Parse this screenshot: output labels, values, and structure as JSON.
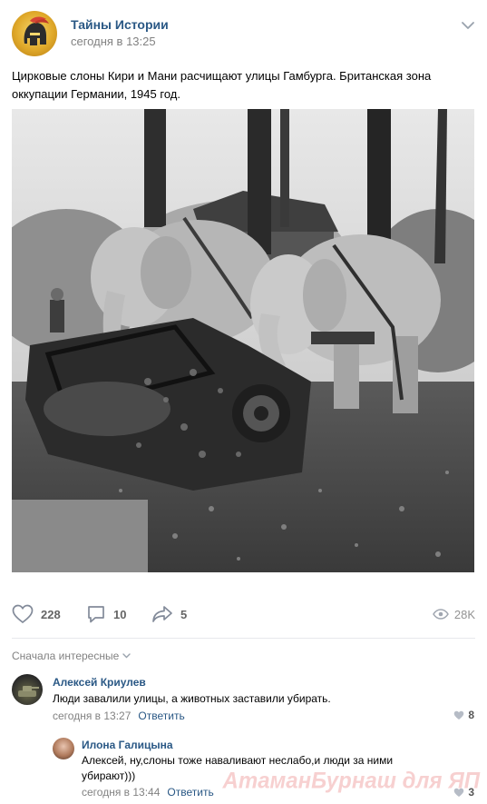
{
  "post": {
    "author": "Тайны Истории",
    "time": "сегодня в 13:25",
    "text": "Цирковые слоны Кири и Мани расчищают улицы Гамбурга. Британская зона оккупации Германии, 1945 год.",
    "avatar_icon": "spartan-helmet-icon"
  },
  "actions": {
    "likes": "228",
    "comments": "10",
    "shares": "5",
    "views": "28K"
  },
  "comments_section": {
    "sort_label": "Сначала интересные"
  },
  "comments": [
    {
      "author": "Алексей Криулев",
      "text": "Люди завалили улицы, а животных заставили убирать.",
      "time": "сегодня в 13:27",
      "reply_label": "Ответить",
      "likes": "8"
    },
    {
      "author": "Илона Галицына",
      "text": "Алексей, ну,слоны тоже наваливают неслабо,и люди за ними убирают)))",
      "time": "сегодня в 13:44",
      "reply_label": "Ответить",
      "likes": "3"
    }
  ],
  "watermark": "АтаманБурнаш для ЯП",
  "colors": {
    "link": "#2a5885",
    "muted": "#828282",
    "divider": "#e7e8ec"
  }
}
